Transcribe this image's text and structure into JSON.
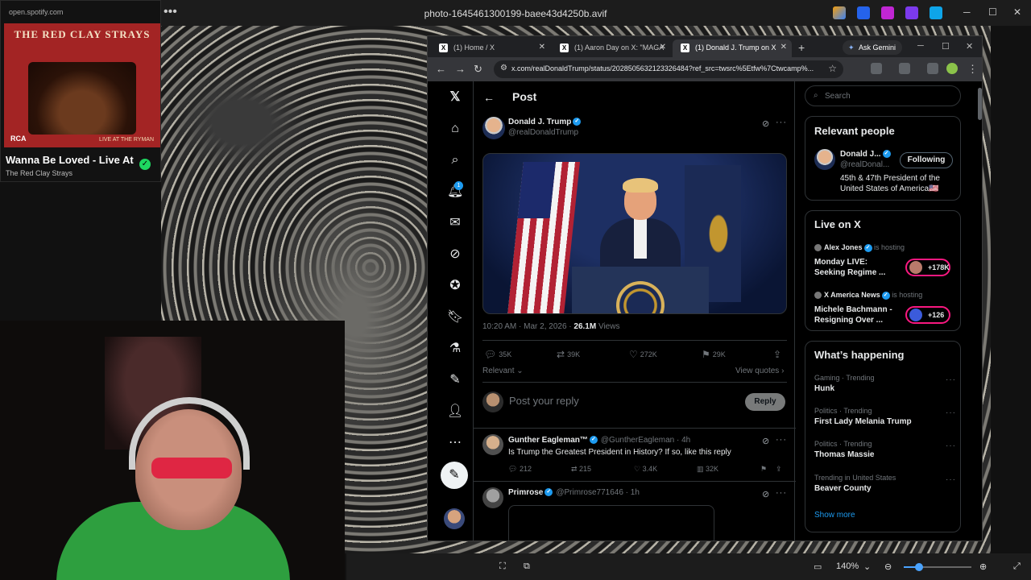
{
  "viewer": {
    "title": "photo-1645461300199-baee43d4250b.avif",
    "zoom": "140%",
    "more": "•••"
  },
  "spotify": {
    "url": "open.spotify.com",
    "cover_band": "THE RED CLAY STRAYS",
    "cover_label": "RCA",
    "cover_venue": "LIVE AT THE RYMAN",
    "song": "Wanna Be Loved - Live At",
    "artist": "The Red Clay Strays"
  },
  "browser": {
    "tabs": [
      {
        "label": "(1) Home / X"
      },
      {
        "label": "(1) Aaron Day on X: \"MAGA"
      },
      {
        "label": "(1) Donald J. Trump on X"
      }
    ],
    "ask_gemini": "Ask Gemini",
    "url": "x.com/realDonaldTrump/status/2028505632123326484?ref_src=twsrc%5Etfw%7Ctwcamp%..."
  },
  "x": {
    "header_title": "Post",
    "notif_count": "1",
    "post": {
      "author_name": "Donald J. Trump",
      "author_handle": "@realDonaldTrump",
      "time": "10:20 AM · Mar 2, 2026 · ",
      "views_count": "26.1M",
      "views_label": " Views",
      "stats": {
        "replies": "35K",
        "reposts": "39K",
        "likes": "272K",
        "bookmarks": "29K"
      }
    },
    "sort_label": "Relevant",
    "view_quotes": "View quotes",
    "reply_placeholder": "Post your reply",
    "reply_button": "Reply",
    "replies": [
      {
        "name": "Gunther Eagleman™",
        "handle": "@GuntherEagleman · 4h",
        "text": "Is Trump the Greatest President in History?  If so,  like this reply",
        "stats": {
          "replies": "212",
          "reposts": "215",
          "likes": "3.4K",
          "views": "32K"
        }
      },
      {
        "name": "Primrose",
        "handle": "@Primrose771646 · 1h"
      }
    ],
    "sidebar": {
      "search_placeholder": "Search",
      "relevant_people": {
        "title": "Relevant people",
        "name": "Donald J...",
        "handle": "@realDonal...",
        "button": "Following",
        "bio": "45th & 47th President of the United States of America🇺🇸"
      },
      "live": {
        "title": "Live on X",
        "items": [
          {
            "host": "Alex Jones",
            "hosting": " is hosting",
            "title": "Monday LIVE: Seeking Regime ...",
            "count": "+178K"
          },
          {
            "host": "X America News",
            "hosting": " is hosting",
            "title": "Michele Bachmann - Resigning Over ...",
            "count": "+126"
          }
        ]
      },
      "happening": {
        "title": "What’s happening",
        "trends": [
          {
            "category": "Gaming · Trending",
            "name": "Hunk"
          },
          {
            "category": "Politics · Trending",
            "name": "First Lady Melania Trump"
          },
          {
            "category": "Politics · Trending",
            "name": "Thomas Massie"
          },
          {
            "category": "Trending in United States",
            "name": "Beaver County"
          }
        ],
        "show_more": "Show more"
      }
    }
  },
  "colors": {
    "x_blue": "#1d9bf0",
    "live_pink": "#f91880",
    "spotify_green": "#1ed760"
  }
}
